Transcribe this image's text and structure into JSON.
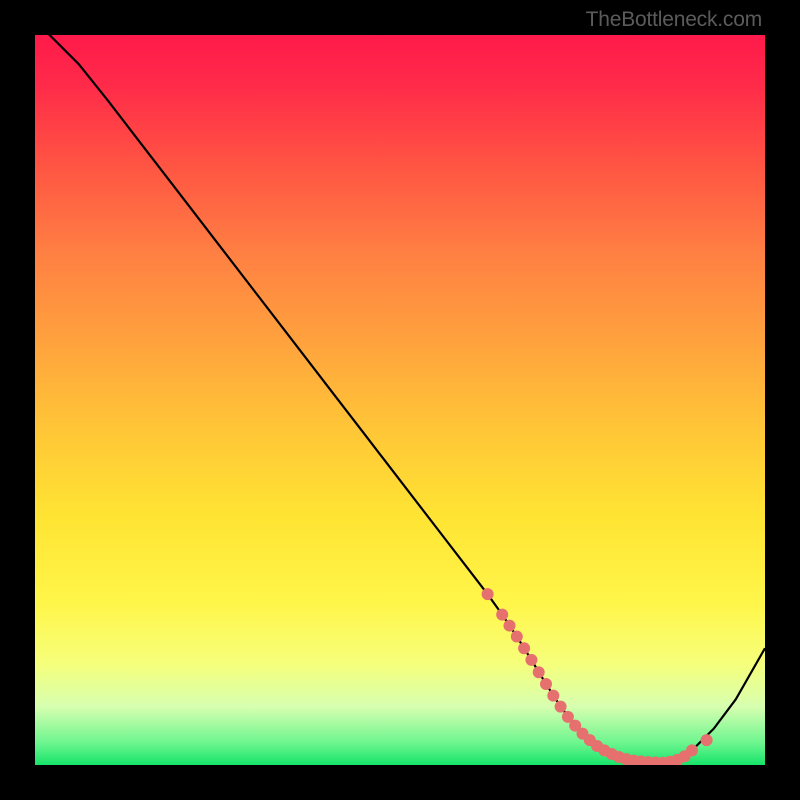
{
  "watermark": "TheBottleneck.com",
  "chart_data": {
    "type": "line",
    "title": "",
    "xlabel": "",
    "ylabel": "",
    "xlim": [
      0,
      100
    ],
    "ylim": [
      0,
      100
    ],
    "series": [
      {
        "name": "bottleneck-curve",
        "x": [
          0,
          6,
          10,
          15,
          20,
          25,
          30,
          35,
          40,
          45,
          50,
          55,
          60,
          62,
          64,
          66,
          68,
          70,
          72,
          74,
          76,
          78,
          80,
          82,
          84,
          86,
          88,
          90,
          93,
          96,
          100
        ],
        "y": [
          102,
          96,
          91,
          84.5,
          78,
          71.5,
          65,
          58.5,
          52,
          45.5,
          39,
          32.5,
          26,
          23.4,
          20.6,
          17.6,
          14.4,
          11.1,
          8.0,
          5.4,
          3.4,
          2.0,
          1.1,
          0.6,
          0.4,
          0.3,
          0.7,
          2.0,
          5.0,
          9.0,
          16.0
        ]
      }
    ],
    "markers": {
      "name": "flat-bottom-points",
      "x": [
        62,
        64,
        65,
        66,
        67,
        68,
        69,
        70,
        71,
        72,
        73,
        74,
        75,
        76,
        77,
        78,
        79,
        80,
        81,
        82,
        83,
        84,
        85,
        86,
        87,
        88,
        89,
        90,
        92
      ],
      "y": [
        23.4,
        20.6,
        19.1,
        17.6,
        16.0,
        14.4,
        12.7,
        11.1,
        9.5,
        8.0,
        6.6,
        5.4,
        4.3,
        3.4,
        2.6,
        2.0,
        1.5,
        1.1,
        0.8,
        0.6,
        0.5,
        0.4,
        0.35,
        0.3,
        0.45,
        0.7,
        1.2,
        2.0,
        3.4
      ],
      "color": "#e5706e",
      "size": 6
    },
    "colors": {
      "line": "#000000",
      "marker": "#e5706e",
      "gradient_stops": [
        "#ff1a4b",
        "#ff5543",
        "#ffa23d",
        "#ffe433",
        "#f6ff7a",
        "#16e46a"
      ]
    }
  }
}
